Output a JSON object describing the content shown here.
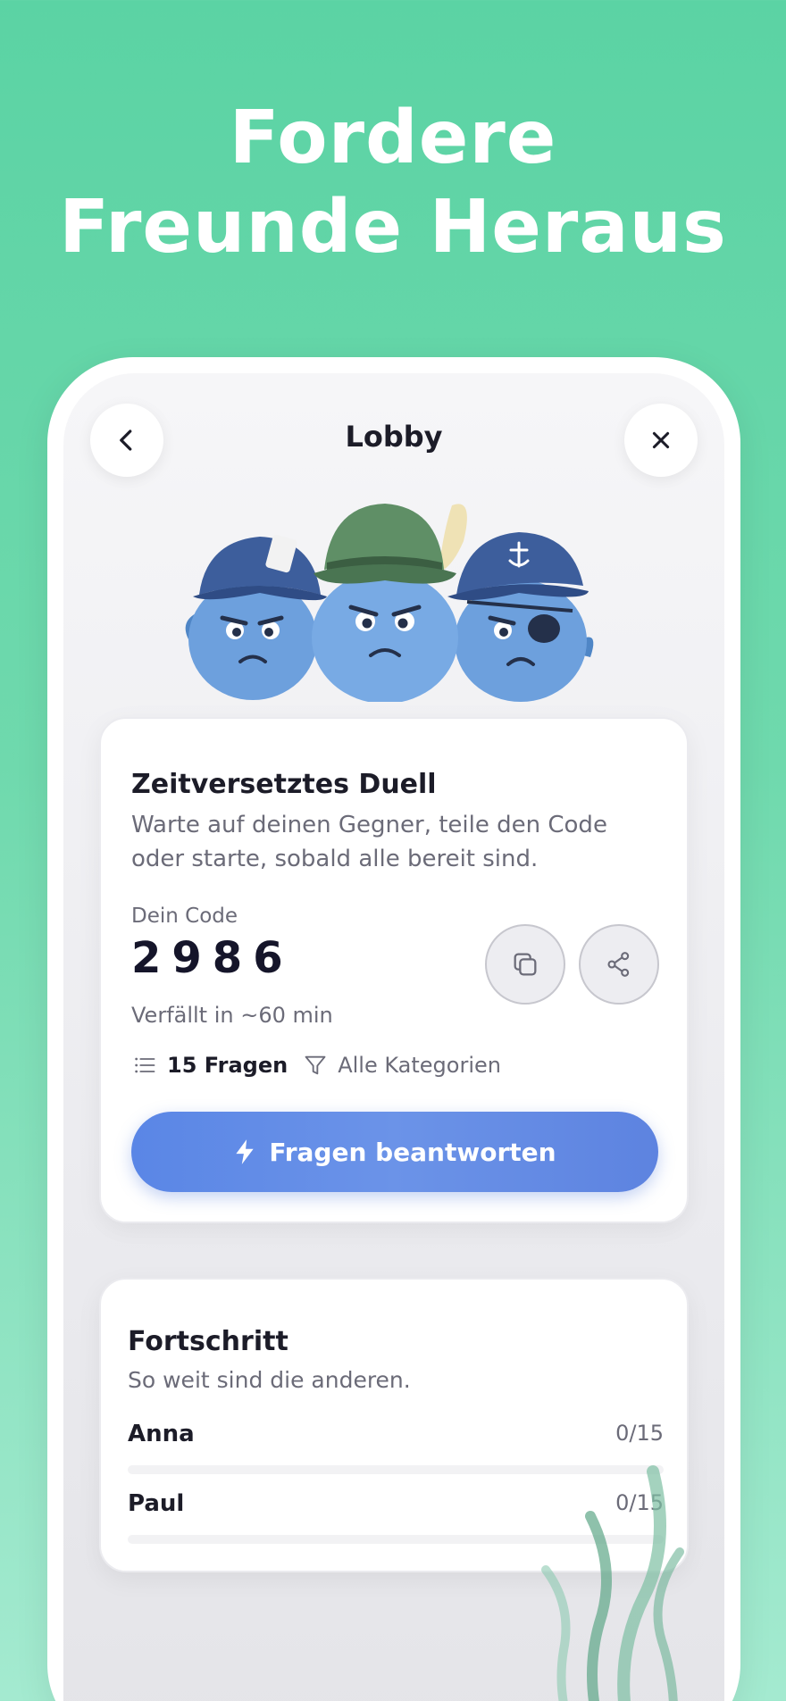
{
  "headline": {
    "line1": "Fordere",
    "line2": "Freunde Heraus"
  },
  "header": {
    "title": "Lobby",
    "back_icon": "chevron-left-icon",
    "close_icon": "close-icon"
  },
  "duel": {
    "title": "Zeitversetztes Duell",
    "description": "Warte auf deinen Gegner, teile den Code oder starte, sobald alle bereit sind.",
    "code_label": "Dein Code",
    "code": "2986",
    "expires": "Verfällt in ~60 min",
    "copy_icon": "copy-icon",
    "share_icon": "share-icon",
    "questions": "15 Fragen",
    "categories": "Alle Kategorien",
    "button_label": "Fragen beantworten"
  },
  "progress": {
    "title": "Fortschritt",
    "subtitle": "So weit sind die anderen.",
    "players": [
      {
        "name": "Anna",
        "score": "0/15",
        "fraction": 0
      },
      {
        "name": "Paul",
        "score": "0/15",
        "fraction": 0
      }
    ]
  },
  "colors": {
    "background": "#5bd3a4",
    "accent": "#5a86e6",
    "text": "#1c1c28",
    "muted": "#6b6b78"
  }
}
